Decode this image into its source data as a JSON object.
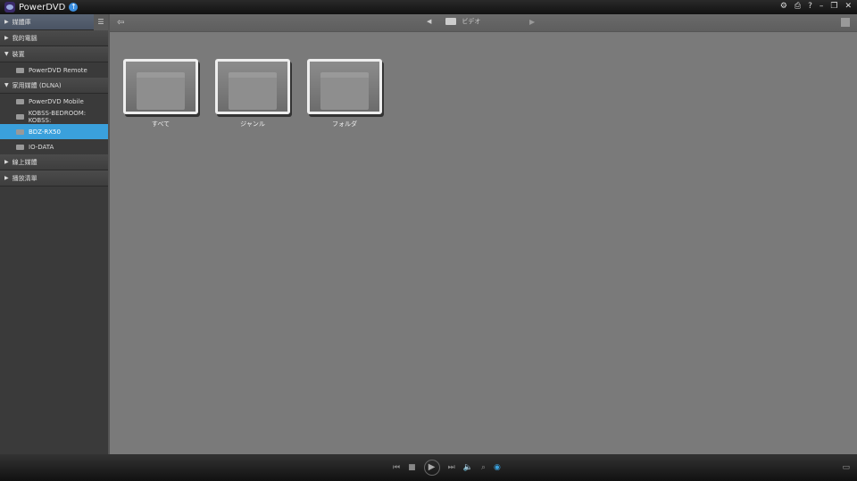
{
  "app": {
    "title": "PowerDVD"
  },
  "sidebar": {
    "library": "媒體庫",
    "my_computer": "我的電腦",
    "devices": "裝置",
    "devices_items": [
      "PowerDVD Remote"
    ],
    "home_media": "家用媒體 (DLNA)",
    "home_items": [
      "PowerDVD Mobile",
      "KOBSS-BEDROOM: KOBSS:",
      "BDZ-RX50",
      "IO-DATA"
    ],
    "selected": "BDZ-RX50",
    "online_media": "線上媒體",
    "playlist": "播放清單"
  },
  "topbar": {
    "breadcrumb": "ビデオ"
  },
  "folders": [
    {
      "label": "すべて"
    },
    {
      "label": "ジャンル"
    },
    {
      "label": "フォルダ"
    }
  ],
  "colors": {
    "accent": "#3aa0dc"
  }
}
